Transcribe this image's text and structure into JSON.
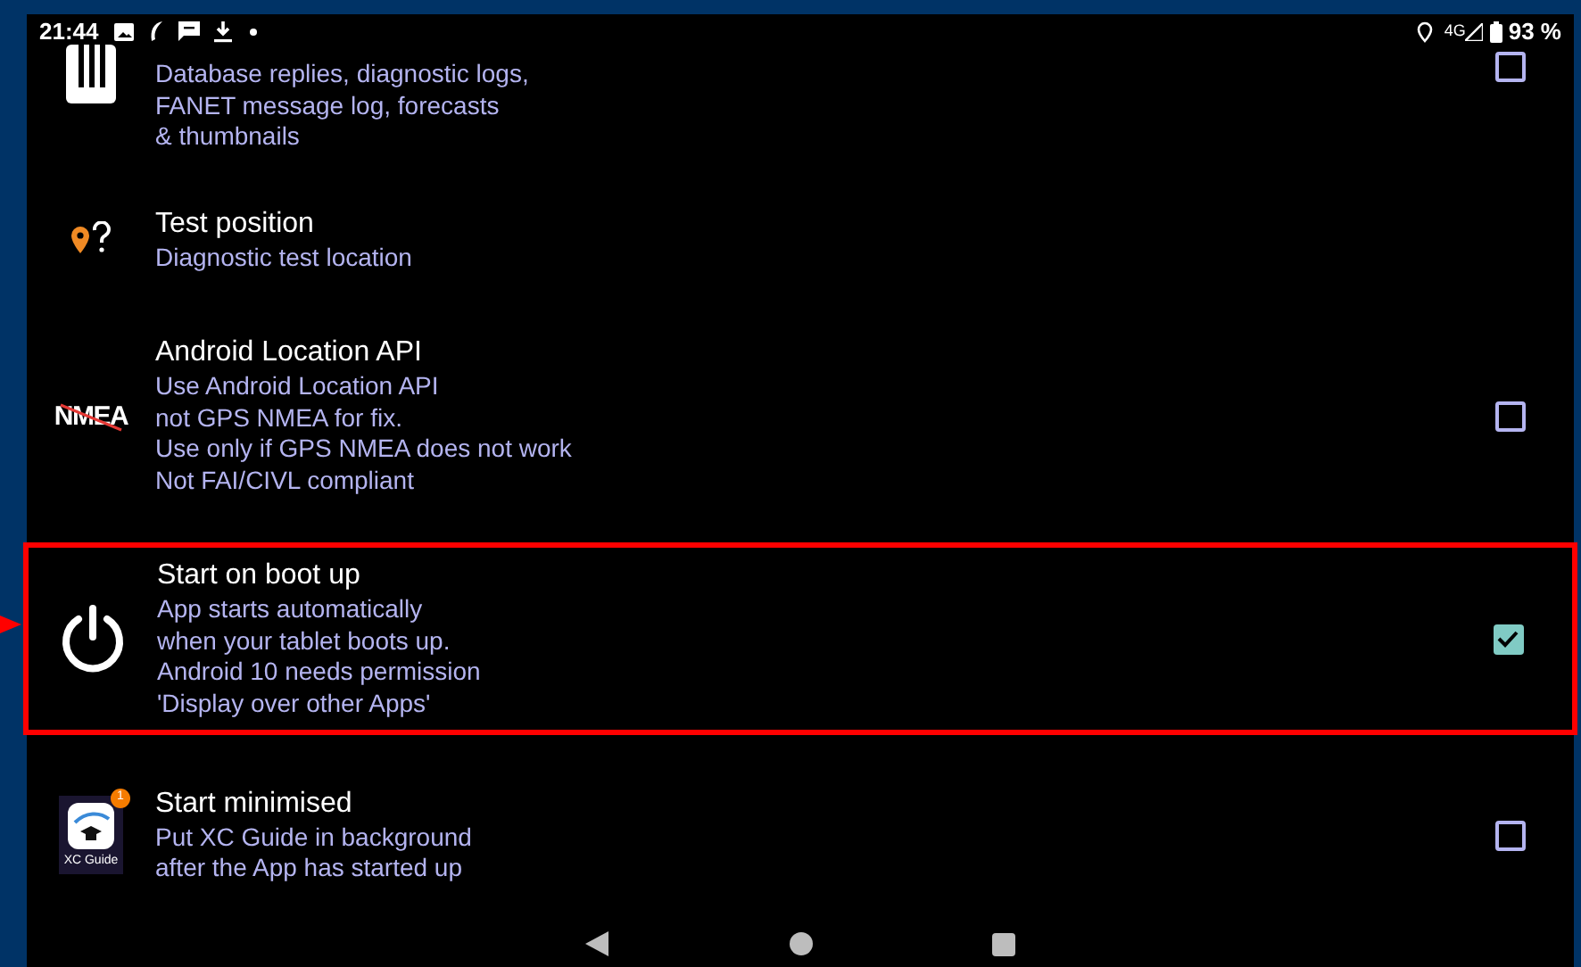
{
  "status_bar": {
    "time": "21:44",
    "network": "4G",
    "battery": "93 %"
  },
  "settings": [
    {
      "kind": "checkbox",
      "subtitle": [
        "Database replies, diagnostic logs,",
        "FANET message log, forecasts",
        "& thumbnails"
      ],
      "checked": false,
      "highlighted": false
    },
    {
      "kind": "text",
      "title": "Test position",
      "subtitle": [
        "Diagnostic test location"
      ],
      "highlighted": false
    },
    {
      "kind": "checkbox",
      "icon_text": "NMEA",
      "title": "Android Location API",
      "subtitle": [
        "Use Android Location API",
        "not GPS NMEA for fix.",
        "Use only if GPS NMEA does not work",
        "Not FAI/CIVL compliant"
      ],
      "checked": false,
      "highlighted": false
    },
    {
      "kind": "checkbox",
      "title": "Start on boot up",
      "subtitle": [
        "App starts automatically",
        "when your tablet boots up.",
        "Android 10 needs permission",
        "'Display over other Apps'"
      ],
      "checked": true,
      "highlighted": true
    },
    {
      "kind": "checkbox",
      "icon_text": "XC Guide",
      "badge": "1",
      "title": "Start minimised",
      "subtitle": [
        "Put XC Guide in background",
        "after the App has started up"
      ],
      "checked": false,
      "highlighted": false
    }
  ]
}
